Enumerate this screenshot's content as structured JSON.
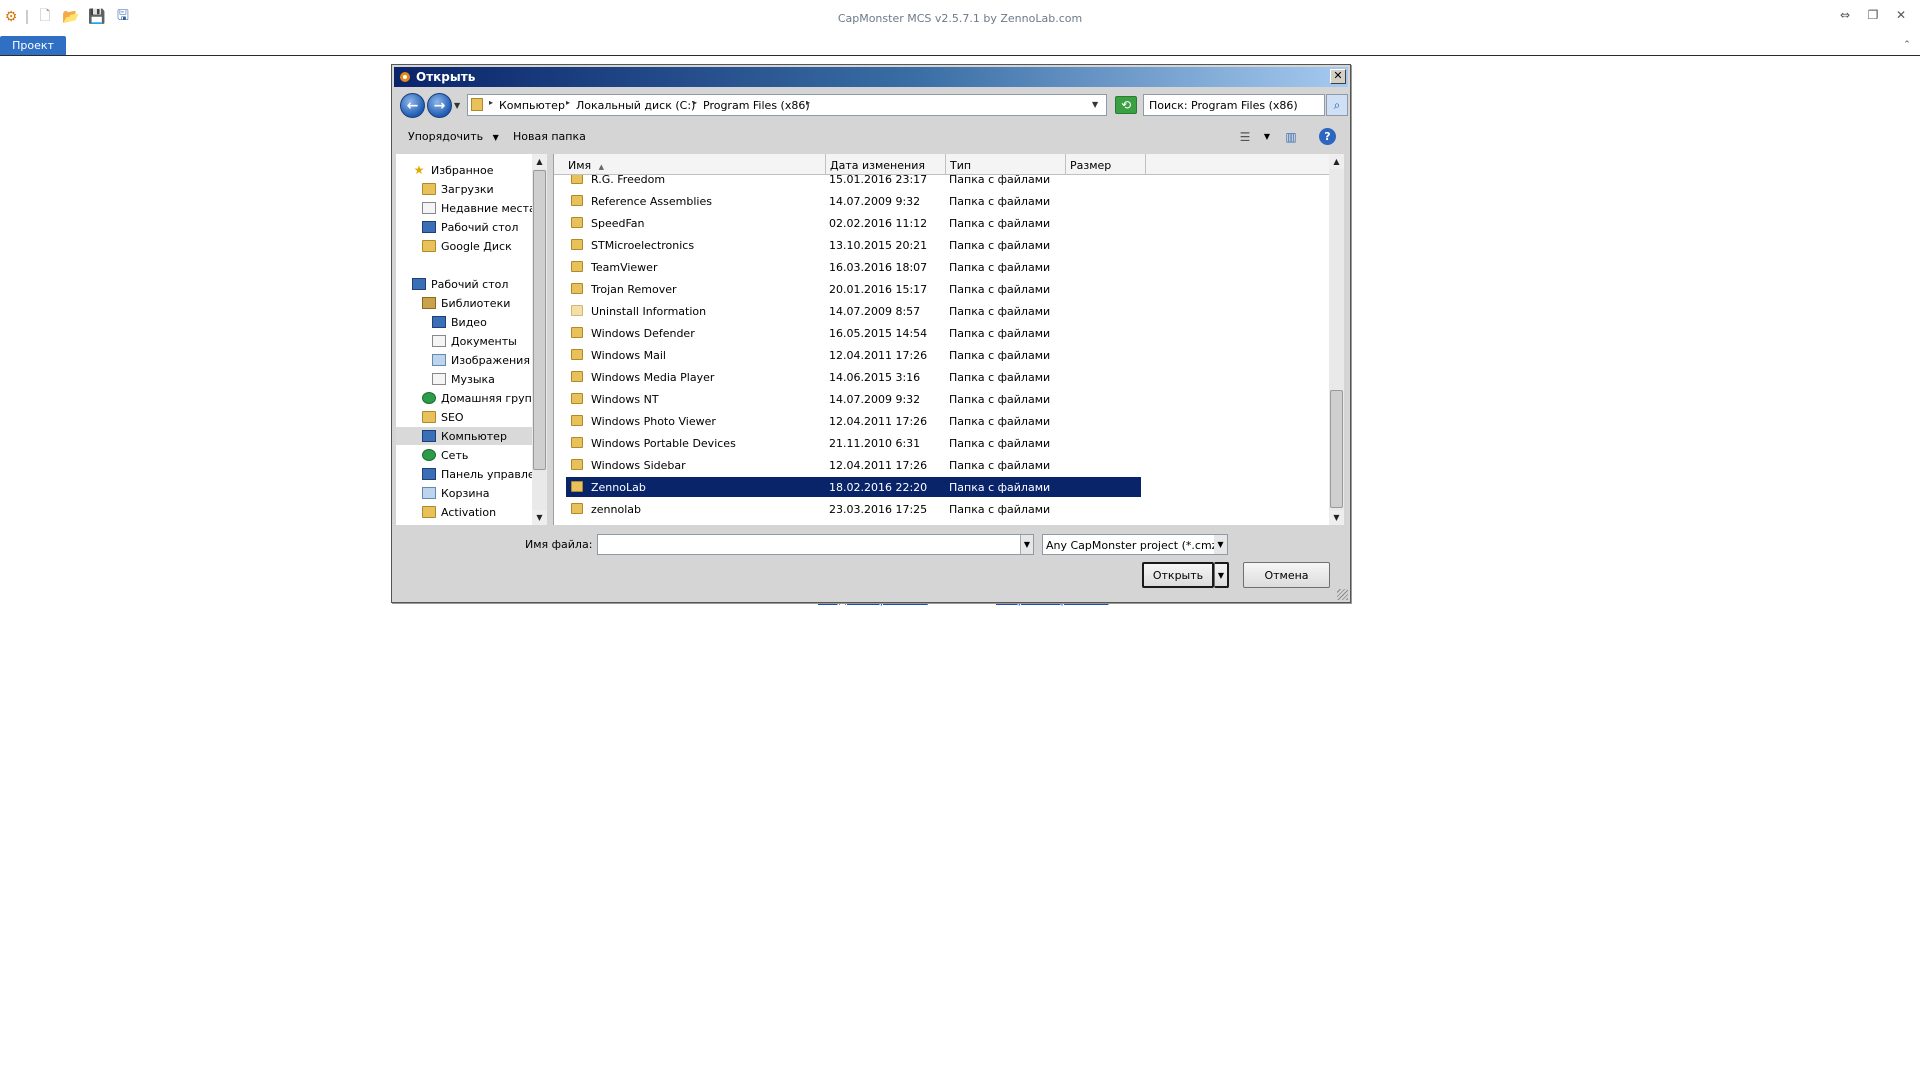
{
  "app": {
    "title": "CapMonster MCS v2.5.7.1 by ZennoLab.com",
    "ribbon_tab": "Проект",
    "under_links": [
      "создать проект...",
      "открыть проект..."
    ]
  },
  "dialog": {
    "title": "Открыть",
    "breadcrumbs": [
      "Компьютер",
      "Локальный диск (C:)",
      "Program Files (x86)"
    ],
    "search_placeholder": "Поиск: Program Files (x86)",
    "toolbar": {
      "organize": "Упорядочить",
      "new_folder": "Новая папка"
    },
    "nav": {
      "favorites": "Избранное",
      "favorites_items": [
        "Загрузки",
        "Недавние места",
        "Рабочий стол",
        "Google Диск"
      ],
      "desktop": "Рабочий стол",
      "libraries": "Библиотеки",
      "library_items": [
        "Видео",
        "Документы",
        "Изображения",
        "Музыка"
      ],
      "homegroup": "Домашняя группа",
      "seo": "SEO",
      "computer": "Компьютер",
      "network": "Сеть",
      "control_panel": "Панель управления",
      "recycle_bin": "Корзина",
      "activation": "Activation"
    },
    "columns": {
      "name": "Имя",
      "date": "Дата изменения",
      "type": "Тип",
      "size": "Размер"
    },
    "files": [
      {
        "name": "R.G. Freedom",
        "date": "15.01.2016 23:17",
        "type": "Папка с файлами"
      },
      {
        "name": "Reference Assemblies",
        "date": "14.07.2009 9:32",
        "type": "Папка с файлами"
      },
      {
        "name": "SpeedFan",
        "date": "02.02.2016 11:12",
        "type": "Папка с файлами"
      },
      {
        "name": "STMicroelectronics",
        "date": "13.10.2015 20:21",
        "type": "Папка с файлами"
      },
      {
        "name": "TeamViewer",
        "date": "16.03.2016 18:07",
        "type": "Папка с файлами"
      },
      {
        "name": "Trojan Remover",
        "date": "20.01.2016 15:17",
        "type": "Папка с файлами"
      },
      {
        "name": "Uninstall Information",
        "date": "14.07.2009 8:57",
        "type": "Папка с файлами"
      },
      {
        "name": "Windows Defender",
        "date": "16.05.2015 14:54",
        "type": "Папка с файлами"
      },
      {
        "name": "Windows Mail",
        "date": "12.04.2011 17:26",
        "type": "Папка с файлами"
      },
      {
        "name": "Windows Media Player",
        "date": "14.06.2015 3:16",
        "type": "Папка с файлами"
      },
      {
        "name": "Windows NT",
        "date": "14.07.2009 9:32",
        "type": "Папка с файлами"
      },
      {
        "name": "Windows Photo Viewer",
        "date": "12.04.2011 17:26",
        "type": "Папка с файлами"
      },
      {
        "name": "Windows Portable Devices",
        "date": "21.11.2010 6:31",
        "type": "Папка с файлами"
      },
      {
        "name": "Windows Sidebar",
        "date": "12.04.2011 17:26",
        "type": "Папка с файлами"
      },
      {
        "name": "ZennoLab",
        "date": "18.02.2016 22:20",
        "type": "Папка с файлами"
      },
      {
        "name": "zennolab",
        "date": "23.03.2016 17:25",
        "type": "Папка с файлами"
      }
    ],
    "selected_file": "ZennoLab",
    "filename_label": "Имя файла:",
    "filename_value": "",
    "filter": "Any CapMonster project (*.cmz",
    "open_button": "Открыть",
    "cancel_button": "Отмена"
  },
  "colors": {
    "selection": "#0a246a",
    "ribbon_tab": "#2f6fc4",
    "titlebar_start": "#0a246a",
    "titlebar_end": "#a6caf0"
  }
}
